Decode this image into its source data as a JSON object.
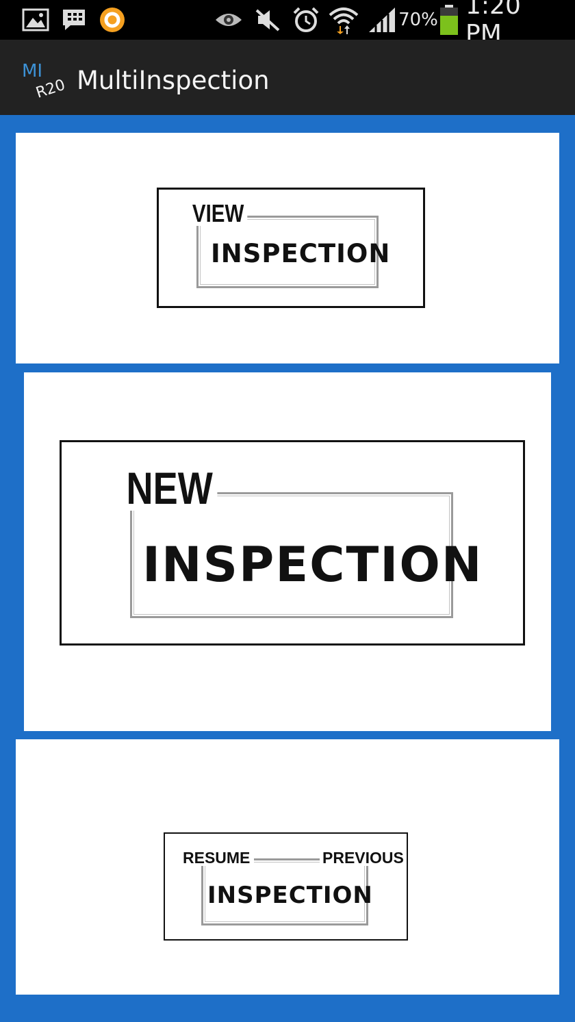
{
  "status_bar": {
    "icons": {
      "left": [
        "gallery-icon",
        "bbm-icon",
        "app-circle-icon"
      ],
      "right": [
        "eye-icon",
        "mute-icon",
        "alarm-icon",
        "wifi-icon",
        "signal-icon",
        "battery-icon"
      ]
    },
    "battery_percent": "70%",
    "battery_level": 0.7,
    "time": "1:20 PM",
    "colors": {
      "battery": "#7cc11c",
      "app_circle": "#f5a020"
    }
  },
  "app_bar": {
    "logo_text_top": "MI",
    "logo_text_bottom": "R20",
    "title": "MultiInspection"
  },
  "cards": {
    "view": {
      "line1": "VIEW",
      "line2": "INSPECTION"
    },
    "new": {
      "line1": "NEW",
      "line2": "INSPECTION"
    },
    "resume": {
      "line1_left": "RESUME",
      "line1_right": "PREVIOUS",
      "line2": "INSPECTION"
    }
  },
  "colors": {
    "background": "#1e6fc8",
    "app_bar": "#222222",
    "status_bar": "#000000"
  }
}
